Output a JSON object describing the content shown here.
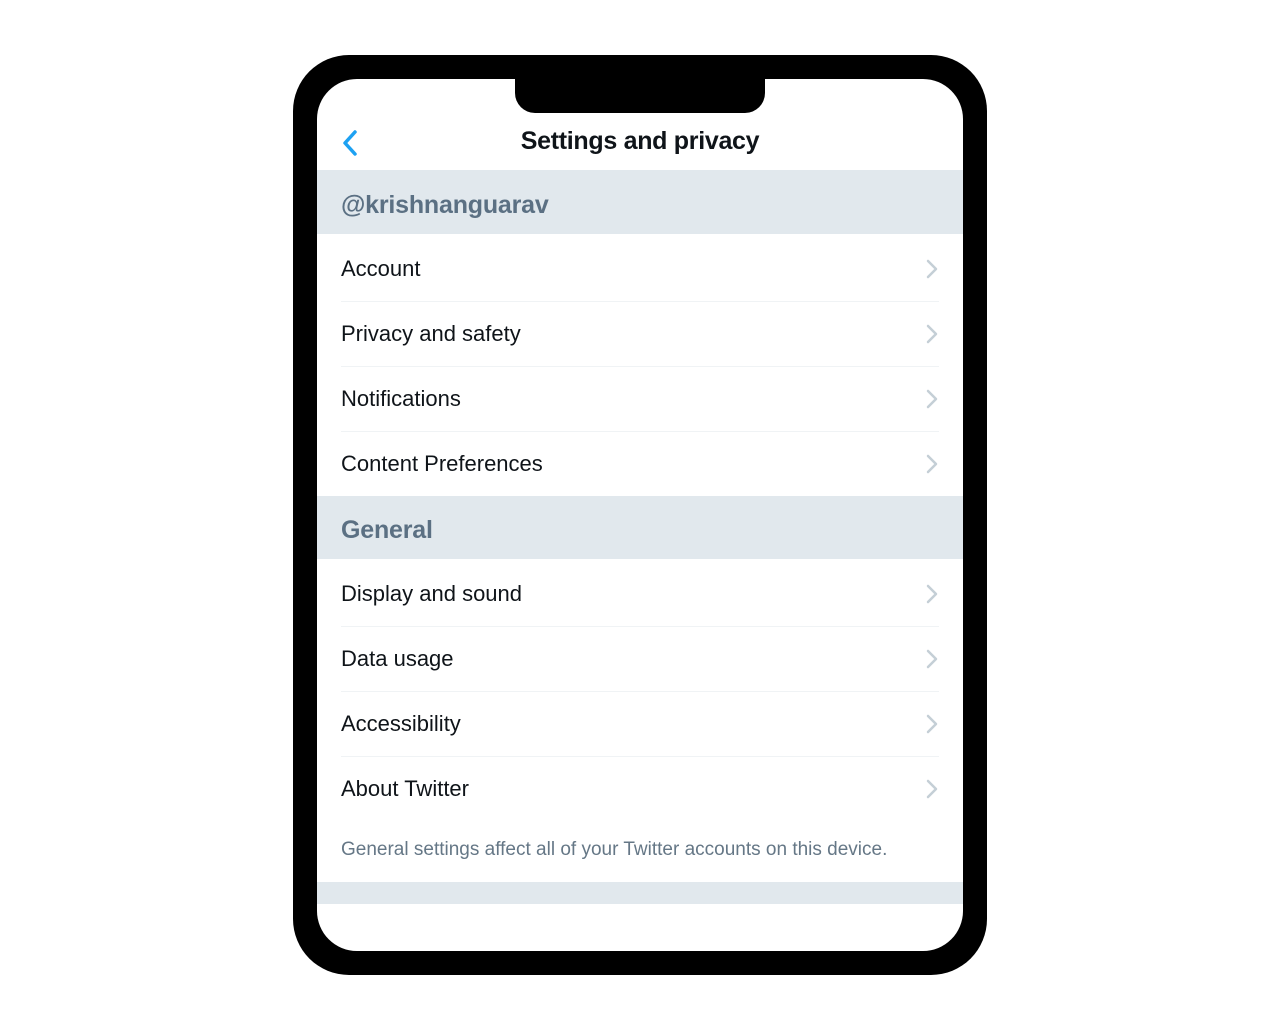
{
  "header": {
    "title": "Settings and privacy"
  },
  "sections": [
    {
      "header": "@krishnanguarav",
      "items": [
        {
          "label": "Account"
        },
        {
          "label": "Privacy and safety"
        },
        {
          "label": "Notifications"
        },
        {
          "label": "Content Preferences"
        }
      ]
    },
    {
      "header": "General",
      "items": [
        {
          "label": "Display and sound"
        },
        {
          "label": "Data usage"
        },
        {
          "label": "Accessibility"
        },
        {
          "label": "About Twitter"
        }
      ],
      "footer": "General settings affect all of your Twitter accounts on this device."
    }
  ],
  "colors": {
    "accent": "#1da1f2",
    "sectionHeaderBg": "#e1e8ed",
    "sectionHeaderText": "#5b7083",
    "chevron": "#c4cfd6",
    "footerText": "#657786"
  }
}
